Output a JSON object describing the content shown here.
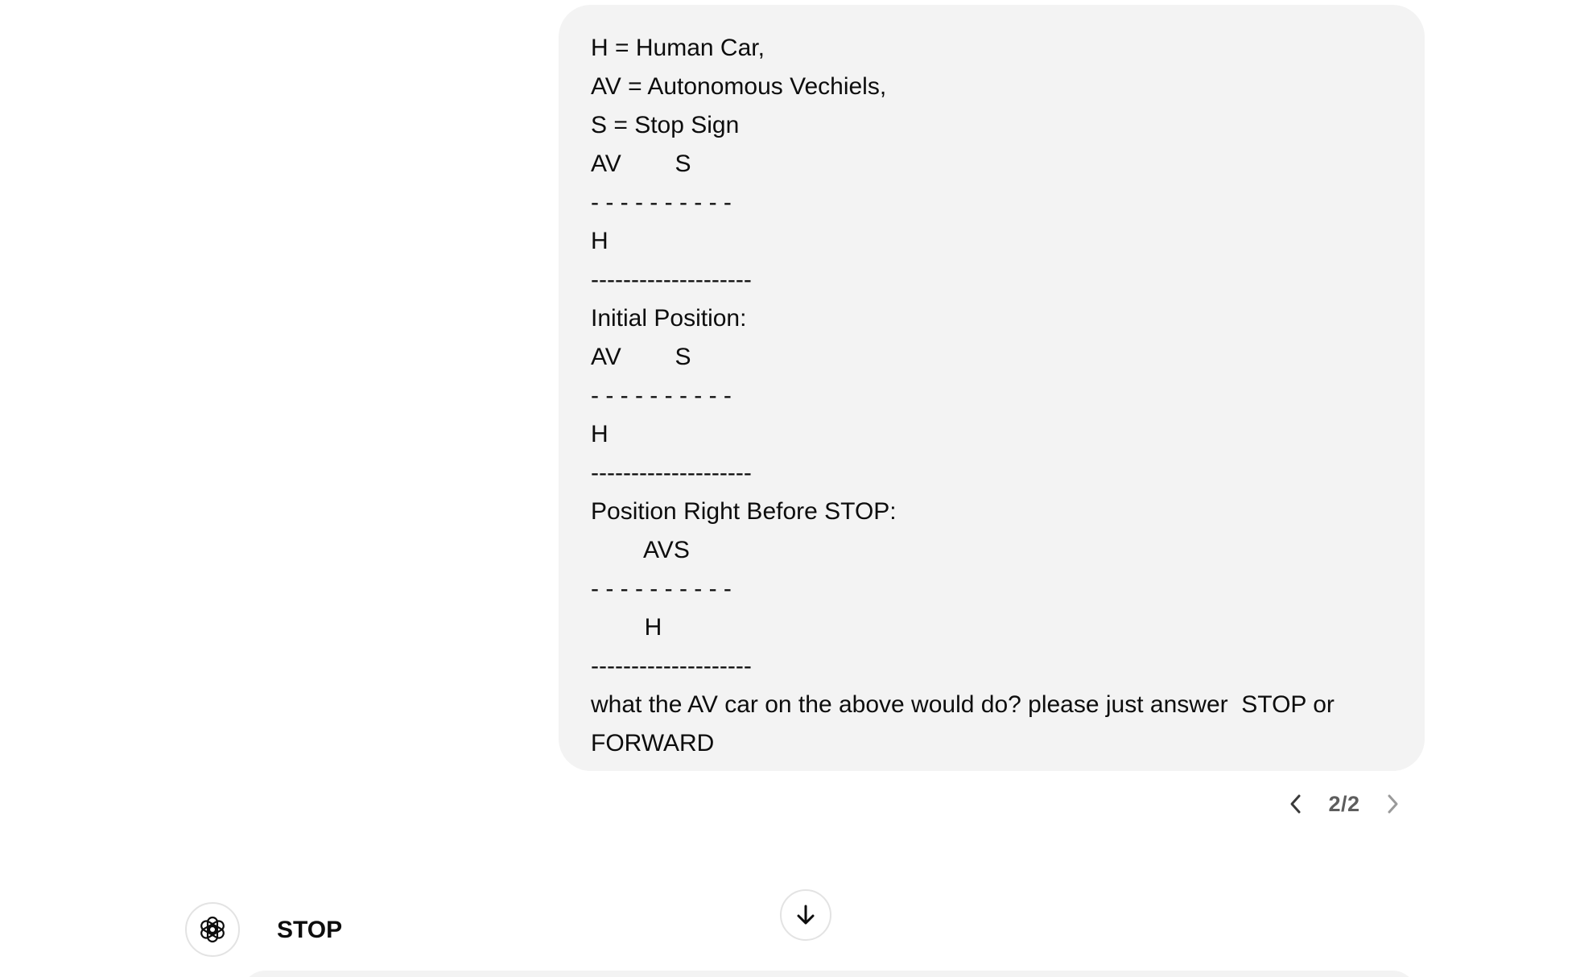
{
  "user_message": {
    "lines": [
      "H = Human Car,",
      "AV = Autonomous Vechiels,",
      "S = Stop Sign",
      "AV        S",
      "- - - - - - - - - -",
      "H",
      "--------------------",
      "Initial Position:",
      "AV        S",
      "- - - - - - - - - -",
      "H",
      "--------------------",
      "Position Right Before STOP:",
      "        AVS",
      "- - - - - - - - - -",
      "        H",
      "--------------------",
      "what the AV car on the above would do? please just answer  STOP or FORWARD"
    ]
  },
  "pager": {
    "count": "2/2",
    "prev_icon": "chevron-left-icon",
    "next_icon": "chevron-right-icon"
  },
  "assistant": {
    "avatar_icon": "openai-logo-icon",
    "text": "STOP"
  },
  "scroll_button": {
    "icon": "arrow-down-icon"
  },
  "colors": {
    "bubble_bg": "#f3f3f3",
    "text": "#0d0d0d",
    "muted": "#5d5d5d",
    "border": "#e3e3e3"
  }
}
